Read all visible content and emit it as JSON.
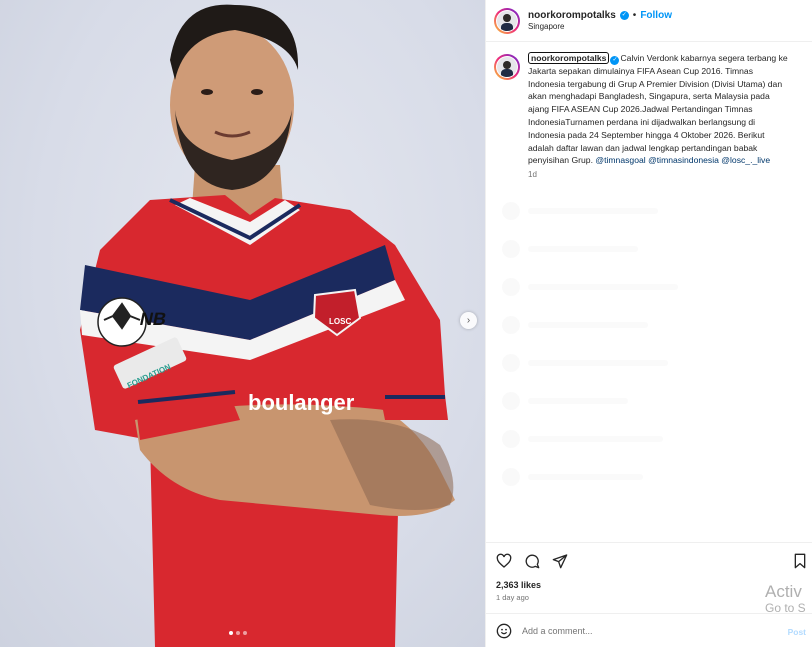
{
  "header": {
    "username": "noorkorompotalks",
    "bullet": "•",
    "follow_label": "Follow",
    "location": "Singapore"
  },
  "caption": {
    "username": "noorkorompotalks",
    "text": "Calvin Verdonk kabarnya segera terbang ke Jakarta sepakan dimulainya FIFA Asean Cup 2016. Timnas Indonesia tergabung di Grup A Premier Division (Divisi Utama) dan akan menghadapi Bangladesh, Singapura, serta Malaysia pada ajang FIFA ASEAN Cup 2026.Jadwal Pertandingan Timnas IndonesiaTurnamen perdana ini dijadwalkan berlangsung di Indonesia pada 24 September hingga 4 Oktober 2026. Berikut adalah daftar lawan dan jadwal lengkap pertandingan babak penyisihan Grup.",
    "mentions": [
      "@timnasgoal",
      "@timnasindonesia",
      "@losc_._live"
    ],
    "age": "1d"
  },
  "post": {
    "likes": "2,363 likes",
    "time_ago": "1 day ago"
  },
  "comment": {
    "placeholder": "Add a comment...",
    "post_label": "Post"
  },
  "photo": {
    "sponsor_text": "boulanger",
    "badge_text": "LOSC",
    "sleeve_patch": "FONDATION",
    "carousel_dots": 3,
    "active_dot": 0
  },
  "watermark": {
    "line1": "Activ",
    "line2": "Go to S"
  },
  "colors": {
    "jersey_red": "#d8282f",
    "jersey_navy": "#1b2a5e",
    "accent_blue": "#0095f6"
  }
}
